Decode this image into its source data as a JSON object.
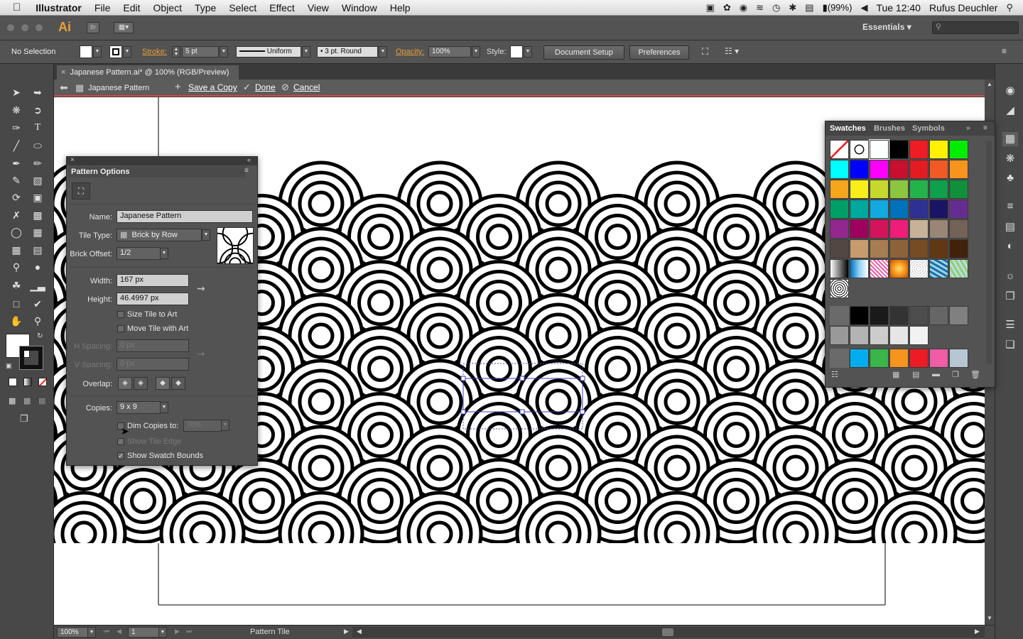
{
  "menubar": {
    "app": "Illustrator",
    "items": [
      "File",
      "Edit",
      "Object",
      "Type",
      "Select",
      "Effect",
      "View",
      "Window",
      "Help"
    ],
    "battery": "(99%)",
    "clock": "Tue 12:40",
    "user": "Rufus Deuchler"
  },
  "appbar": {
    "logo": "Ai",
    "bridge": "Br",
    "workspace": "Essentials"
  },
  "control": {
    "selection": "No Selection",
    "stroke_label": "Stroke:",
    "stroke_value": "5 pt",
    "profile": "Uniform",
    "brush": "3 pt. Round",
    "opacity_label": "Opacity:",
    "opacity_value": "100%",
    "style_label": "Style:",
    "doc_setup": "Document Setup",
    "preferences": "Preferences"
  },
  "document": {
    "tab_title": "Japanese Pattern.ai* @ 100% (RGB/Preview)",
    "iso_name": "Japanese Pattern",
    "save_copy": "Save a Copy",
    "done": "Done",
    "cancel": "Cancel"
  },
  "pattern_options": {
    "title": "Pattern Options",
    "name_label": "Name:",
    "name_value": "Japanese Pattern",
    "tile_type_label": "Tile Type:",
    "tile_type_value": "Brick by Row",
    "brick_offset_label": "Brick Offset:",
    "brick_offset_value": "1/2",
    "width_label": "Width:",
    "width_value": "167 px",
    "height_label": "Height:",
    "height_value": "46.4997 px",
    "size_tile": "Size Tile to Art",
    "move_tile": "Move Tile with Art",
    "hspacing_label": "H Spacing:",
    "hspacing_value": "0 px",
    "vspacing_label": "V Spacing:",
    "vspacing_value": "0 px",
    "overlap_label": "Overlap:",
    "copies_label": "Copies:",
    "copies_value": "9 x 9",
    "dim_copies": "Dim Copies to:",
    "dim_value": "70%",
    "show_tile_edge": "Show Tile Edge",
    "show_swatch_bounds": "Show Swatch Bounds"
  },
  "swatches_panel": {
    "tabs": [
      "Swatches",
      "Brushes",
      "Symbols"
    ],
    "colors": [
      "#000000",
      "#ee1c24",
      "#fff200",
      "#00ed00",
      "#00ffff",
      "#0000ff",
      "#ff00ff",
      "#c8102e",
      "#e31b23",
      "#f15a24",
      "#f7941d",
      "#f7a51a",
      "#f9ed1b",
      "#c5d92d",
      "#8cc63f",
      "#24b34b",
      "#0ea04a",
      "#118f3c",
      "#009f68",
      "#00a99d",
      "#12a9df",
      "#0072bc",
      "#2e3192",
      "#1b1464",
      "#662d91",
      "#92278f",
      "#9e005d",
      "#d4145a",
      "#ed1e79",
      "#c7b299",
      "#998675",
      "#736357",
      "#534741",
      "#c69c6d",
      "#a67c52",
      "#8c6239",
      "#754c24",
      "#603813",
      "#42210b"
    ],
    "grays1": [
      "#000000",
      "#1a1a1a",
      "#333333",
      "#4d4d4d",
      "#666666",
      "#808080"
    ],
    "grays2": [
      "#999999",
      "#b3b3b3",
      "#cccccc",
      "#e6e6e6",
      "#f2f2f2"
    ],
    "brights": [
      "#00aeef",
      "#39b54a",
      "#f7941d",
      "#ed1c24",
      "#ee5da5",
      "#b6c7d3"
    ]
  },
  "statusbar": {
    "zoom": "100%",
    "artboard": "1",
    "status": "Pattern Tile"
  }
}
